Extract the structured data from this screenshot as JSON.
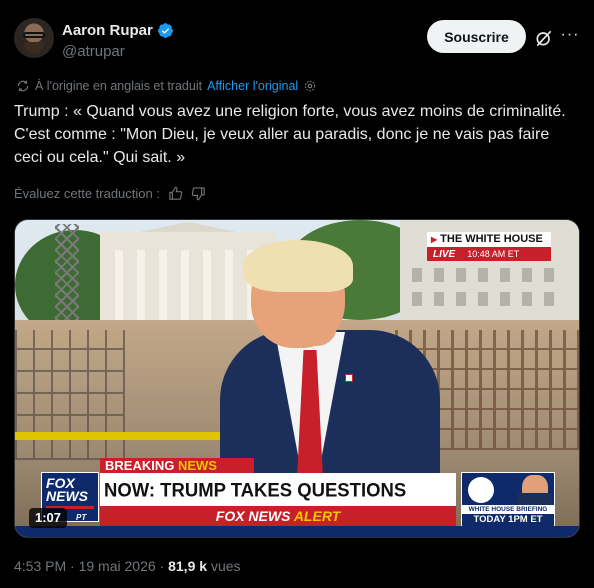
{
  "author": {
    "name": "Aaron Rupar",
    "handle": "@atrupar",
    "verified": true
  },
  "actions": {
    "subscribe_label": "Souscrire",
    "grok_icon": "grok-icon",
    "more_icon": "more-icon",
    "more_glyph": "···"
  },
  "translation": {
    "notice": "À l'origine en anglais et traduit",
    "show_original": "Afficher l'original"
  },
  "tweet": {
    "text": "Trump : « Quand vous avez une religion forte, vous avez moins de criminalité. C'est comme : \"Mon Dieu, je veux aller au paradis, donc je ne vais pas faire ceci ou cela.\" Qui sait. »"
  },
  "rating": {
    "label": "Évaluez cette traduction :"
  },
  "video": {
    "duration": "1:07",
    "overlay": {
      "location": "THE WHITE HOUSE",
      "live": "LIVE",
      "time": "10:48 AM ET",
      "breaking": "BREAKING",
      "breaking_news": "NEWS",
      "headline": "NOW: TRUMP TAKES QUESTIONS FROM REPORTERS",
      "alert_brand": "FOX NEWS",
      "alert_word": "ALERT",
      "logo_line1": "FOX",
      "logo_line2": "NEWS",
      "logo_sub": "PT",
      "briefing_title": "WHITE HOUSE BRIEFING",
      "briefing_time": "TODAY 1PM ET"
    }
  },
  "meta": {
    "time": "4:53 PM",
    "date": "19 mai 2026",
    "views_count": "81,9 k",
    "views_label": "vues"
  },
  "colors": {
    "accent": "#1d9bf0",
    "text_primary": "#e7e9ea",
    "text_secondary": "#71767b",
    "fox_red": "#c8202a",
    "fox_blue": "#0e2a6b"
  }
}
